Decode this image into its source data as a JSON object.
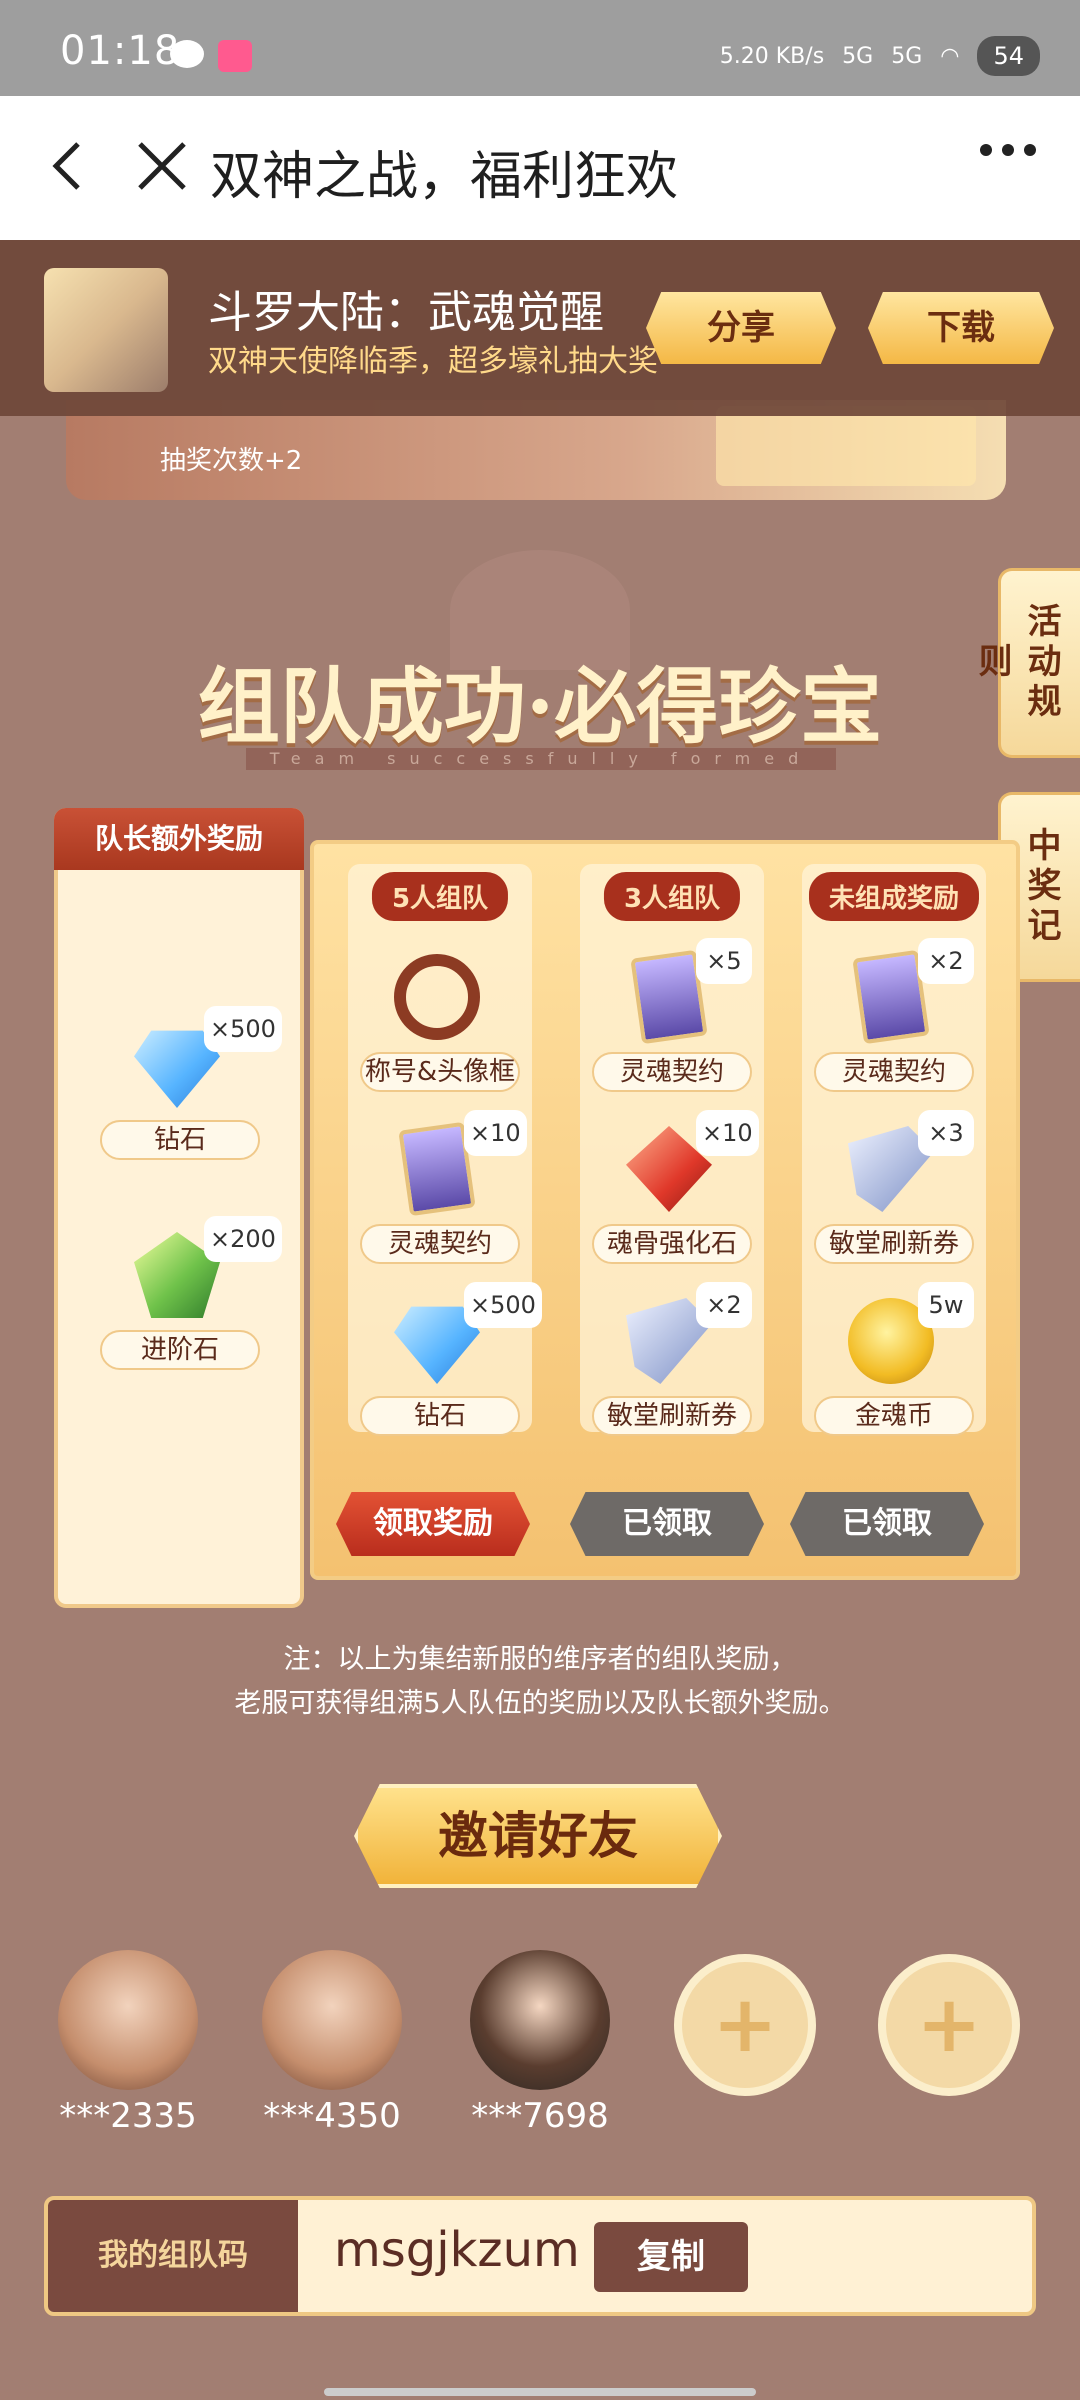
{
  "status_bar": {
    "time": "01:18",
    "net_speed": "5.20 KB/s",
    "network_1": "5G",
    "network_2": "5G",
    "battery": "54"
  },
  "title_bar": {
    "title": "双神之战，福利狂欢"
  },
  "app_banner": {
    "name": "斗罗大陆：武魂觉醒",
    "desc": "双神天使降临季，超多壕礼抽大奖",
    "share_label": "分享",
    "download_label": "下载"
  },
  "prev_card": {
    "text": "抽奖次数+2"
  },
  "section": {
    "title": "组队成功·必得珍宝",
    "subtitle": "Team successfully formed"
  },
  "side_tabs": {
    "rules": "活动规则",
    "records": "中奖记录"
  },
  "leader": {
    "tag": "队长额外奖励",
    "items": [
      {
        "label": "钻石",
        "qty": "×500",
        "icon": "diamond-icon"
      },
      {
        "label": "进阶石",
        "qty": "×200",
        "icon": "advance-stone-icon"
      }
    ]
  },
  "columns": [
    {
      "head": "5人组队",
      "items": [
        {
          "label": "称号&头像框",
          "qty": "",
          "icon": "title-frame-icon"
        },
        {
          "label": "灵魂契约",
          "qty": "×10",
          "icon": "soul-contract-icon"
        },
        {
          "label": "钻石",
          "qty": "×500",
          "icon": "diamond-icon"
        }
      ],
      "button": "领取奖励"
    },
    {
      "head": "3人组队",
      "items": [
        {
          "label": "灵魂契约",
          "qty": "×5",
          "icon": "soul-contract-icon"
        },
        {
          "label": "魂骨强化石",
          "qty": "×10",
          "icon": "soul-bone-stone-icon"
        },
        {
          "label": "敏堂刷新券",
          "qty": "×2",
          "icon": "refresh-ticket-icon"
        }
      ],
      "button": "已领取"
    },
    {
      "head": "未组成奖励",
      "items": [
        {
          "label": "灵魂契约",
          "qty": "×2",
          "icon": "soul-contract-icon"
        },
        {
          "label": "敏堂刷新券",
          "qty": "×3",
          "icon": "refresh-ticket-icon"
        },
        {
          "label": "金魂币",
          "qty": "5w",
          "icon": "gold-coin-icon"
        }
      ],
      "button": "已领取"
    }
  ],
  "note": {
    "line1": "注：以上为集结新服的维序者的组队奖励，",
    "line2": "老服可获得组满5人队伍的奖励以及队长额外奖励。"
  },
  "invite_label": "邀请好友",
  "members": [
    "***2335",
    "***4350",
    "***7698"
  ],
  "team_code": {
    "label": "我的组队码",
    "value": "msgjkzum",
    "copy_label": "复制"
  }
}
